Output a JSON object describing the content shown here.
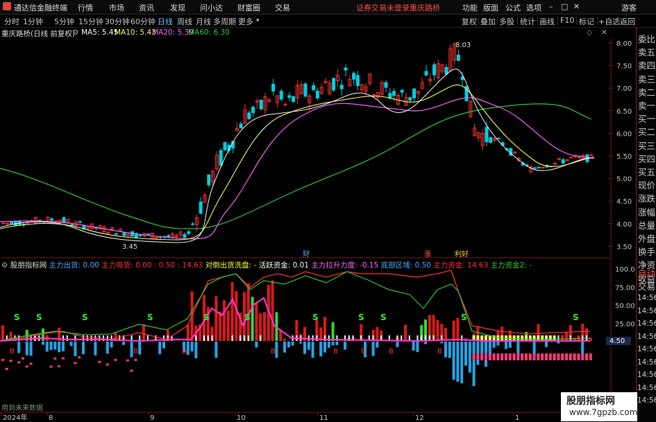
{
  "menubar": {
    "app_title": "通达信金融终端",
    "items": [
      "行情",
      "市场",
      "资讯",
      "发现",
      "问小达",
      "财富圈",
      "交易"
    ],
    "alert": "证券交易未登录",
    "stock": "重庆路桥",
    "right_items": [
      "功能",
      "版面",
      "公式",
      "选项"
    ],
    "guest": "游客",
    "window_controls": {
      "min": "–",
      "max": "□",
      "close": "✕"
    }
  },
  "periodbar": {
    "periods": [
      "分时",
      "1分钟",
      "5分钟",
      "15分钟",
      "30分钟",
      "60分钟",
      "日线",
      "周线",
      "月线",
      "多周期",
      "更多"
    ],
    "active": "日线",
    "tools": [
      "复权",
      "叠加",
      "多股",
      "统计",
      "画线",
      "F10",
      "标记",
      "+自选",
      "返回"
    ]
  },
  "infobar": {
    "stock_label": "重庆路桥(日线 前复权)",
    "ma5": "MA5: 5.45",
    "ma10": "MA10: 5.43",
    "ma20": "MA20: 5.39",
    "ma60": "MA60: 6.30"
  },
  "colors": {
    "up": "#ff3232",
    "down": "#00d0e0",
    "ma5": "#ffffff",
    "ma10": "#ffff66",
    "ma20": "#ff66ff",
    "ma60": "#33cc33",
    "grid": "#7a1a1a",
    "axis": "#c8c8c8"
  },
  "price_axis": {
    "ticks": [
      "8.00",
      "7.50",
      "7.00",
      "6.50",
      "6.00",
      "5.50",
      "5.00",
      "4.50",
      "4.00",
      "3.50"
    ]
  },
  "annotations": {
    "high": "8.03",
    "low": "3.45",
    "marker1": "财",
    "marker2": "涨",
    "marker3": "利好"
  },
  "indicator": {
    "name": "股朋指标网",
    "items": [
      {
        "label": "主力出货: 0.00",
        "color": "#4aa8ff"
      },
      {
        "label": "主力吸货: 0.00 : 0.50 : 14.63",
        "color": "#ff3232"
      },
      {
        "label": "对倒出货洗盘: -",
        "color": "#ffff33"
      },
      {
        "label": "活跃资金: 0.01",
        "color": "#ffffff"
      },
      {
        "label": "主力拉升力度: -0.15",
        "color": "#ff66ff"
      },
      {
        "label": "底部区域: 0.50",
        "color": "#4aa8ff"
      },
      {
        "label": "主力资金: 14.63",
        "color": "#ff3232"
      },
      {
        "label": "主力资金2: -",
        "color": "#33cc33"
      }
    ],
    "axis_ticks": [
      "100.0",
      "75.00",
      "50.00",
      "25.00"
    ],
    "current_value": "4.50"
  },
  "time_axis": {
    "labels": [
      "2024年",
      "8",
      "9",
      "10",
      "11",
      "12",
      "1"
    ]
  },
  "bottom_note": "用到未来数据",
  "right_panel": {
    "items": [
      "委比",
      "卖五",
      "卖四",
      "卖三",
      "卖二",
      "卖一",
      "买一",
      "买二",
      "买三",
      "买四",
      "买五",
      "现价",
      "涨跌",
      "涨幅",
      "总量",
      "外盘",
      "换手",
      "净资",
      "收益"
    ],
    "lower_items": [
      "自动",
      "交易"
    ],
    "times": [
      "14:56",
      "14:56",
      "14:56",
      "14:56",
      "14:56",
      "14:56",
      "14:56",
      "14:56",
      "14:56"
    ]
  },
  "watermark": {
    "line1": "股朋指标网",
    "line2": "www.7gpzb.com"
  }
}
